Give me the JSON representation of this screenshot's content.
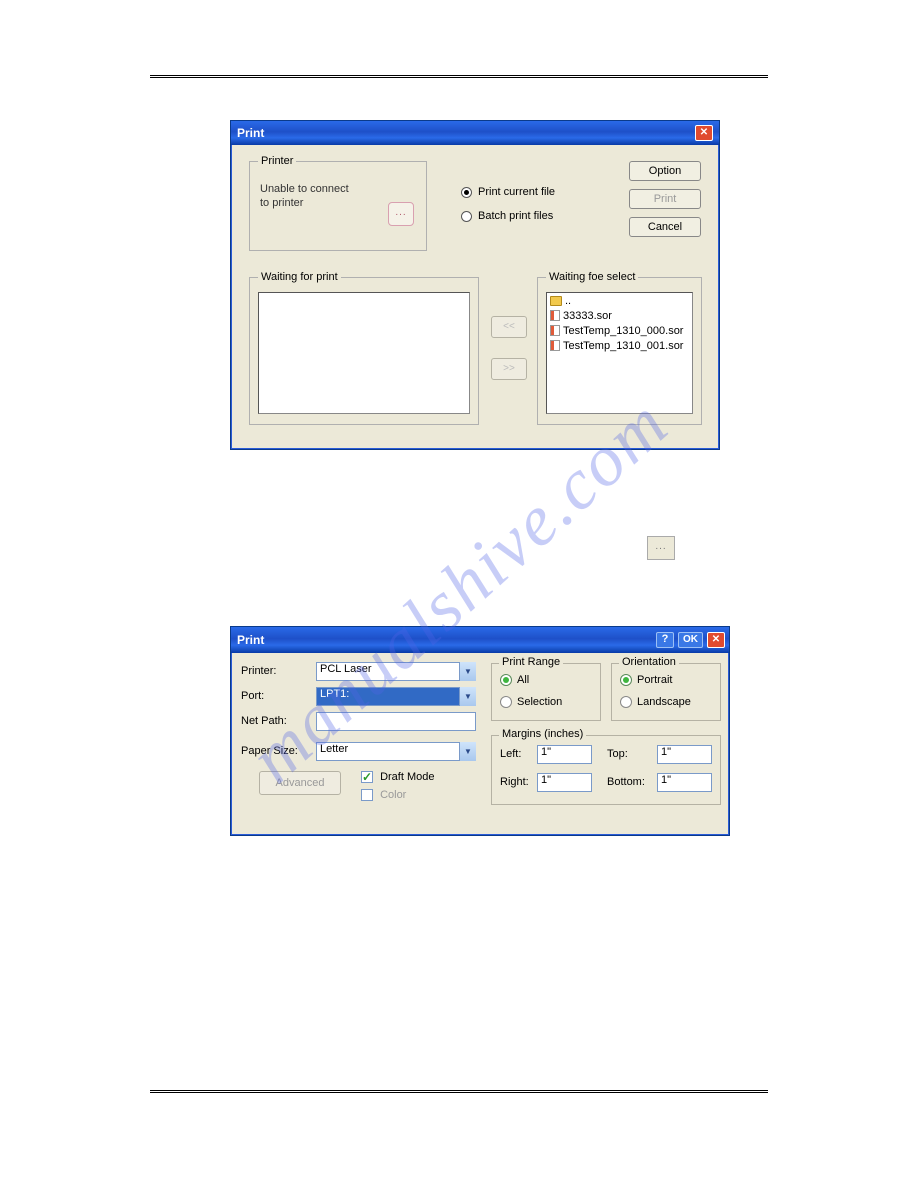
{
  "watermark": "manualshive.com",
  "dialog1": {
    "title": "Print",
    "printer": {
      "legend": "Printer",
      "message_l1": "Unable to connect",
      "message_l2": "to printer",
      "browse": "..."
    },
    "mode": {
      "current": "Print current file",
      "batch": "Batch print files"
    },
    "buttons": {
      "option": "Option",
      "print": "Print",
      "cancel": "Cancel"
    },
    "wait_print_legend": "Waiting for print",
    "wait_select_legend": "Waiting foe select",
    "move_left": "<<",
    "move_right": ">>",
    "files": {
      "parent": "..",
      "f1": "33333.sor",
      "f2": "TestTemp_1310_000.sor",
      "f3": "TestTemp_1310_001.sor"
    }
  },
  "lone_browse": "...",
  "dialog2": {
    "title": "Print",
    "help": "?",
    "ok": "OK",
    "labels": {
      "printer": "Printer:",
      "port": "Port:",
      "netpath": "Net Path:",
      "papersize": "Paper Size:"
    },
    "values": {
      "printer": "PCL Laser",
      "port": "LPT1:",
      "netpath": "",
      "papersize": "Letter"
    },
    "advanced": "Advanced",
    "draft": "Draft Mode",
    "color": "Color",
    "range": {
      "legend": "Print Range",
      "all": "All",
      "selection": "Selection"
    },
    "orientation": {
      "legend": "Orientation",
      "portrait": "Portrait",
      "landscape": "Landscape"
    },
    "margins": {
      "legend": "Margins (inches)",
      "left_l": "Left:",
      "left_v": "1\"",
      "right_l": "Right:",
      "right_v": "1\"",
      "top_l": "Top:",
      "top_v": "1\"",
      "bottom_l": "Bottom:",
      "bottom_v": "1\""
    }
  }
}
